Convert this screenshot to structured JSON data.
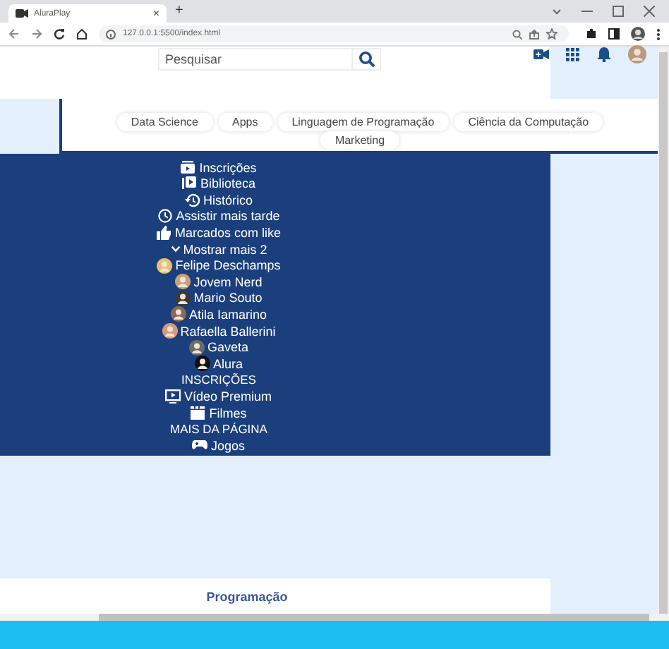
{
  "browser": {
    "tab_title": "AluraPlay",
    "tab_close": "×",
    "new_tab": "+",
    "url": "127.0.0.1:5500/index.html"
  },
  "header": {
    "search": {
      "placeholder": "Pesquisar"
    }
  },
  "chips": [
    {
      "label": "Data Science"
    },
    {
      "label": "Apps"
    },
    {
      "label": "Linguagem de Programação"
    },
    {
      "label": "Ciência da Computação"
    },
    {
      "label": "Marketing"
    }
  ],
  "sidebar": {
    "items": [
      {
        "kind": "link",
        "label": "Inscrições"
      },
      {
        "kind": "link",
        "label": "Biblioteca"
      },
      {
        "kind": "link",
        "label": "Histórico"
      },
      {
        "kind": "link",
        "label": "Assistir mais tarde"
      },
      {
        "kind": "link",
        "label": "Marcados com like"
      },
      {
        "kind": "toggle",
        "label": "Mostrar mais 2"
      },
      {
        "kind": "channel",
        "label": "Felipe Deschamps",
        "color": "#e8c070"
      },
      {
        "kind": "channel",
        "label": "Jovem Nerd",
        "color": "#c9a27a"
      },
      {
        "kind": "channel",
        "label": "Mario Souto",
        "color": "#3a3a3a"
      },
      {
        "kind": "channel",
        "label": "Atila Iamarino",
        "color": "#8a6a50"
      },
      {
        "kind": "channel",
        "label": "Rafaella Ballerini",
        "color": "#d79a7a"
      },
      {
        "kind": "channel",
        "label": "Gaveta",
        "color": "#6b6b6b"
      },
      {
        "kind": "channel",
        "label": "Alura",
        "color": "#111111"
      },
      {
        "kind": "header",
        "label": "INSCRIÇÕES"
      },
      {
        "kind": "link",
        "label": "Vídeo Premium"
      },
      {
        "kind": "link",
        "label": "Filmes"
      },
      {
        "kind": "header",
        "label": "MAIS DA PÁGINA"
      },
      {
        "kind": "link",
        "label": "Jogos"
      }
    ]
  },
  "footer_card": {
    "title": "Programação"
  }
}
